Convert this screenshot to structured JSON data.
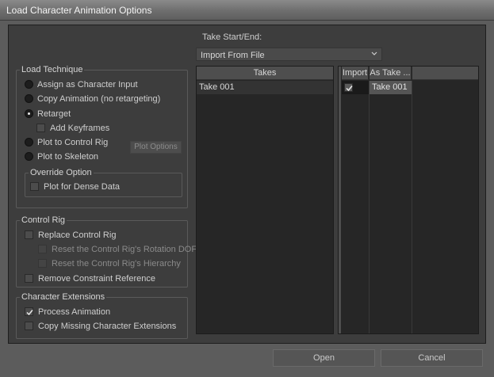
{
  "window": {
    "title": "Load Character Animation Options"
  },
  "take_range": {
    "label": "Take Start/End:",
    "selected": "Import From File"
  },
  "load_technique": {
    "title": "Load Technique",
    "options": [
      {
        "label": "Assign as Character Input",
        "checked": false
      },
      {
        "label": "Copy Animation (no retargeting)",
        "checked": false
      },
      {
        "label": "Retarget",
        "checked": true
      },
      {
        "label": "Plot to Control Rig",
        "checked": false
      },
      {
        "label": "Plot to Skeleton",
        "checked": false
      }
    ],
    "add_keyframes": {
      "label": "Add Keyframes",
      "checked": false
    },
    "plot_options_label": "Plot Options",
    "override": {
      "title": "Override Option",
      "plot_dense": {
        "label": "Plot for Dense Data",
        "checked": false
      }
    }
  },
  "control_rig": {
    "title": "Control Rig",
    "replace": {
      "label": "Replace Control Rig",
      "checked": false
    },
    "reset_rotation": {
      "label": "Reset the Control Rig's Rotation DOF",
      "checked": false
    },
    "reset_hierarchy": {
      "label": "Reset the Control Rig's Hierarchy",
      "checked": false
    },
    "remove_constraint": {
      "label": "Remove Constraint Reference",
      "checked": false
    }
  },
  "character_extensions": {
    "title": "Character Extensions",
    "process_animation": {
      "label": "Process Animation",
      "checked": true
    },
    "copy_missing": {
      "label": "Copy Missing Character Extensions",
      "checked": false
    }
  },
  "takes_panel": {
    "header": "Takes",
    "rows": [
      "Take 001"
    ]
  },
  "import_panel": {
    "headers": [
      "Import",
      "As Take ..."
    ],
    "rows": [
      {
        "import": true,
        "as_take": "Take 001"
      }
    ]
  },
  "buttons": {
    "open": "Open",
    "cancel": "Cancel"
  },
  "icons": {
    "chevron": "chevron-down-icon",
    "check": "checkmark-icon"
  }
}
